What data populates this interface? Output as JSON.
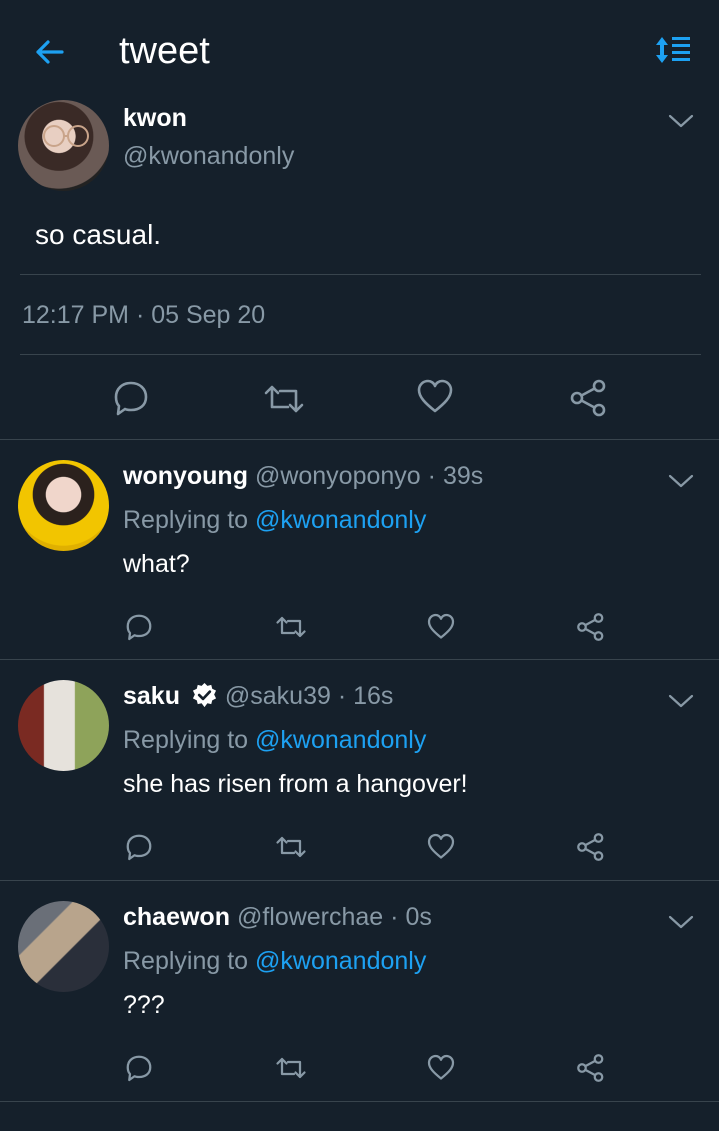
{
  "header": {
    "title": "tweet"
  },
  "main_tweet": {
    "name": "kwon",
    "handle": "@kwonandonly",
    "text": "so casual.",
    "timestamp": "12:17 PM · 05 Sep 20"
  },
  "replies": [
    {
      "name": "wonyoung",
      "handle": "@wonyoponyo",
      "sep": "·",
      "time": "39s",
      "replying_prefix": "Replying to",
      "replying_to": "@kwonandonly",
      "text": "what?",
      "verified": false
    },
    {
      "name": "saku",
      "handle": "@saku39",
      "sep": "·",
      "time": "16s",
      "replying_prefix": "Replying to",
      "replying_to": "@kwonandonly",
      "text": "she has risen from a hangover!",
      "verified": true
    },
    {
      "name": "chaewon",
      "handle": "@flowerchae",
      "sep": "·",
      "time": "0s",
      "replying_prefix": "Replying to",
      "replying_to": "@kwonandonly",
      "text": "???",
      "verified": false
    }
  ],
  "colors": {
    "background": "#15202b",
    "accent": "#1da1f2",
    "muted": "#8899a6",
    "divider": "#38444d"
  },
  "icons": [
    "back-arrow-icon",
    "sort-icon",
    "chevron-down-icon",
    "reply-icon",
    "retweet-icon",
    "like-icon",
    "share-icon",
    "verified-icon"
  ]
}
